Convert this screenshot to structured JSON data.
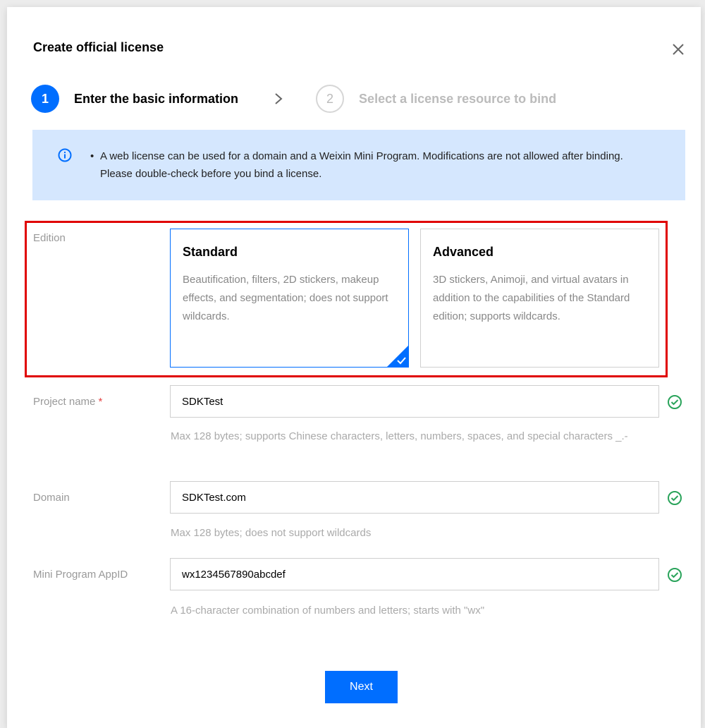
{
  "dialog": {
    "title": "Create official license"
  },
  "steps": [
    {
      "number": "1",
      "label": "Enter the basic information",
      "state": "active"
    },
    {
      "number": "2",
      "label": "Select a license resource to bind",
      "state": "inactive"
    }
  ],
  "notice": {
    "bullet": "•",
    "text": "A web license can be used for a domain and a Weixin Mini Program. Modifications are not allowed after binding. Please double-check before you bind a license."
  },
  "edition": {
    "label": "Edition",
    "options": [
      {
        "title": "Standard",
        "description": "Beautification, filters, 2D stickers, makeup effects, and segmentation; does not support wildcards.",
        "selected": true
      },
      {
        "title": "Advanced",
        "description": "3D stickers, Animoji, and virtual avatars in addition to the capabilities of the Standard edition; supports wildcards.",
        "selected": false
      }
    ]
  },
  "project_name": {
    "label": "Project name",
    "required_mark": "*",
    "value": "SDKTest",
    "hint": "Max 128 bytes; supports Chinese characters, letters, numbers, spaces, and special characters _.-"
  },
  "domain": {
    "label": "Domain",
    "value": "SDKTest.com",
    "hint": "Max 128 bytes; does not support wildcards"
  },
  "appid": {
    "label": "Mini Program AppID",
    "value": "wx1234567890abcdef",
    "hint": "A 16-character combination of numbers and letters; starts with \"wx\""
  },
  "footer": {
    "next_label": "Next"
  },
  "colors": {
    "primary": "#006eff",
    "notice_bg": "#d5e7fe",
    "highlight_border": "#e00000",
    "success": "#29a35a"
  }
}
